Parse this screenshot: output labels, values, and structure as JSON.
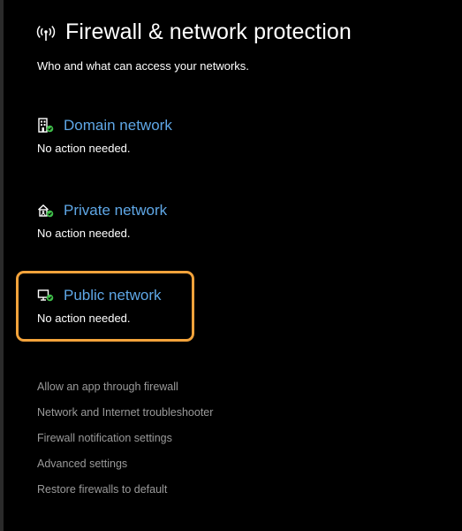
{
  "header": {
    "title": "Firewall & network protection",
    "subtitle": "Who and what can access your networks.",
    "icon": "wifi-antenna-icon"
  },
  "networks": [
    {
      "title": "Domain network",
      "status": "No action needed.",
      "icon": "domain-network-icon",
      "highlighted": false
    },
    {
      "title": "Private network",
      "status": "No action needed.",
      "icon": "private-network-icon",
      "highlighted": false
    },
    {
      "title": "Public network",
      "status": "No action needed.",
      "icon": "public-network-icon",
      "highlighted": true
    }
  ],
  "links": [
    "Allow an app through firewall",
    "Network and Internet troubleshooter",
    "Firewall notification settings",
    "Advanced settings",
    "Restore firewalls to default"
  ],
  "colors": {
    "background": "#000000",
    "link_blue": "#5fa7e6",
    "highlight_orange": "#f3a33b",
    "status_green": "#3fbf4a",
    "secondary_link": "#9a9a9a"
  }
}
